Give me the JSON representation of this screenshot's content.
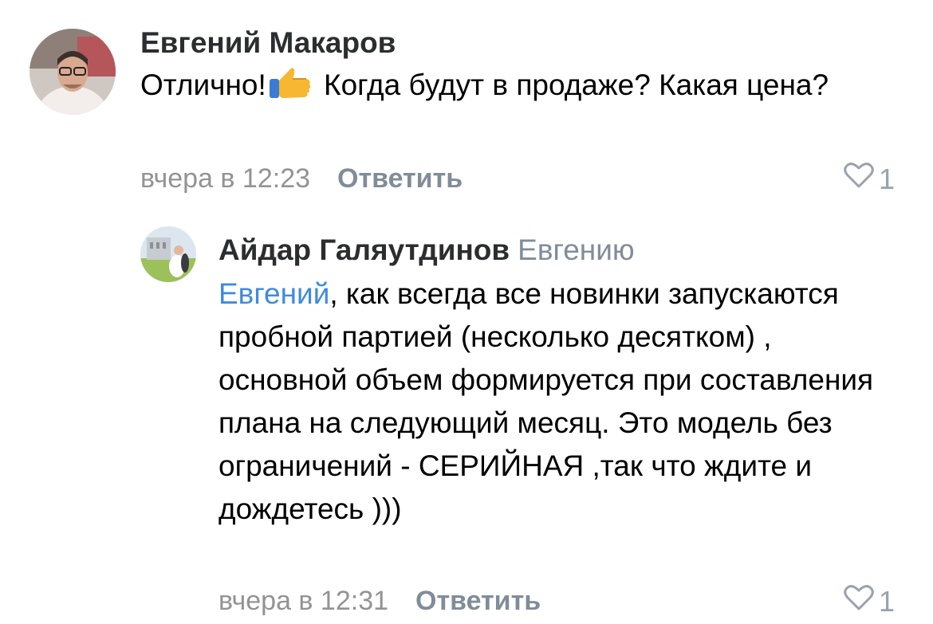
{
  "comments": [
    {
      "author": "Евгений Макаров",
      "text_before_emoji": "Отлично!",
      "emoji": "thumbs-up",
      "text_after_emoji": " Когда будут в продаже? Какая цена?",
      "time": "вчера в 12:23",
      "reply_label": "Ответить",
      "likes": "1"
    }
  ],
  "replies": [
    {
      "author": "Айдар Галяутдинов",
      "reply_to": "Евгению",
      "mention": "Евгений",
      "text": ", как всегда все новинки запускаются пробной партией (несколько десятком) , основной объем формируется при составления плана на следующий месяц. Это модель без ограничений - СЕРИЙНАЯ ,так что ждите и дождетесь )))",
      "time": "вчера в 12:31",
      "reply_label": "Ответить",
      "likes": "1"
    }
  ],
  "colors": {
    "author": "#2c2d2e",
    "mention": "#3f8ae0",
    "secondary": "#818c99",
    "time": "#939393"
  }
}
